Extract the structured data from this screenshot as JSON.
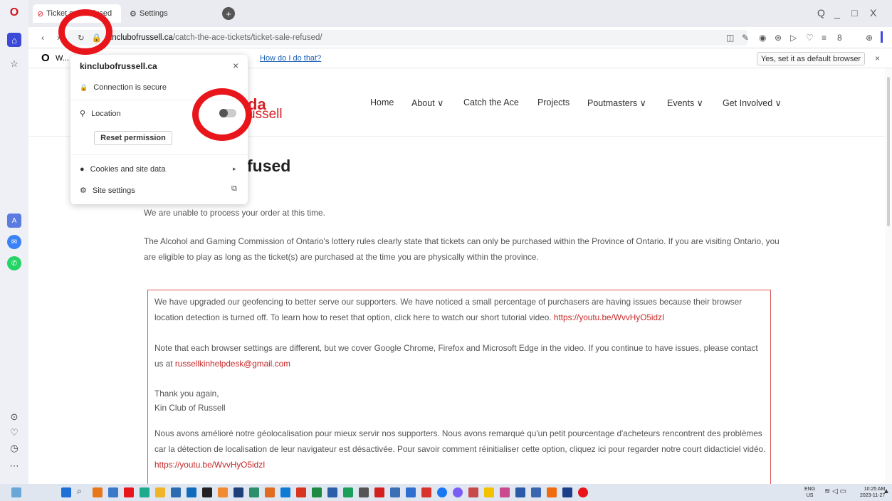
{
  "browser": {
    "tabs": [
      {
        "label": "Ticket sale refused"
      },
      {
        "label": "Settings"
      }
    ],
    "new_tab": "+",
    "window_controls": [
      "Q",
      "_",
      "□",
      "X"
    ],
    "url_domain": "kinclubofrussell.ca",
    "url_path": "/catch-the-ace-tickets/ticket-sale-refused/",
    "infobar": {
      "text": "W...",
      "link": "How do I do that?",
      "button": "Yes, set it as default browser",
      "close": "×"
    }
  },
  "popup": {
    "domain": "kinclubofrussell.ca",
    "close": "×",
    "connection": "Connection is secure",
    "location_label": "Location",
    "location_enabled": false,
    "reset_button": "Reset permission",
    "cookies": "Cookies and site data",
    "site_settings": "Site settings"
  },
  "site": {
    "logo_top": "da",
    "logo_bottom": "ussell",
    "nav": [
      {
        "label": "Home"
      },
      {
        "label": "About ∨"
      },
      {
        "label": "Catch the Ace"
      },
      {
        "label": "Projects"
      },
      {
        "label": "Poutmasters ∨"
      },
      {
        "label": "Events ∨"
      },
      {
        "label": "Get Involved ∨"
      }
    ],
    "page_title": "fused",
    "para1": "We are unable to process your order at this time.",
    "para2": "The Alcohol and Gaming Commission of Ontario's lottery rules clearly state that tickets can only be purchased within the Province of Ontario. If you are visiting Ontario, you are eligible to play as long as the ticket(s) are purchased at the time you are physically within the province.",
    "notice": {
      "p1": "We have upgraded our geofencing to better serve our supporters. We have noticed a small percentage of purchasers are having issues because their browser location detection is turned off. To learn how to reset that option, click here to watch our short tutorial video.",
      "p1_link": "https://youtu.be/WvvHyO5idzI",
      "p2": "Note that each browser settings are different, but we cover Google Chrome, Firefox and Microsoft Edge in the video. If you continue to have issues, please contact us at",
      "p2_link": "russellkinhelpdesk@gmail.com",
      "thanks": "Thank you again,",
      "signature": "Kin Club of Russell",
      "p3": "Nous avons amélioré notre géolocalisation pour mieux servir nos supporters. Nous avons remarqué qu'un petit pourcentage d'acheteurs rencontrent des problèmes car la détection de localisation de leur navigateur est désactivée. Pour savoir comment réinitialiser cette option, cliquez ici pour regarder notre court didacticiel vidéo.",
      "p3_link": "https://youtu.be/WvvHyO5idzI"
    }
  },
  "taskbar": {
    "lang": "ENG",
    "region": "US",
    "time": "10:25 AM",
    "date": "2023-11-27"
  },
  "colors": {
    "annotation_circle": "#e8151b",
    "brand": "#d51f26",
    "link": "#c62828"
  }
}
